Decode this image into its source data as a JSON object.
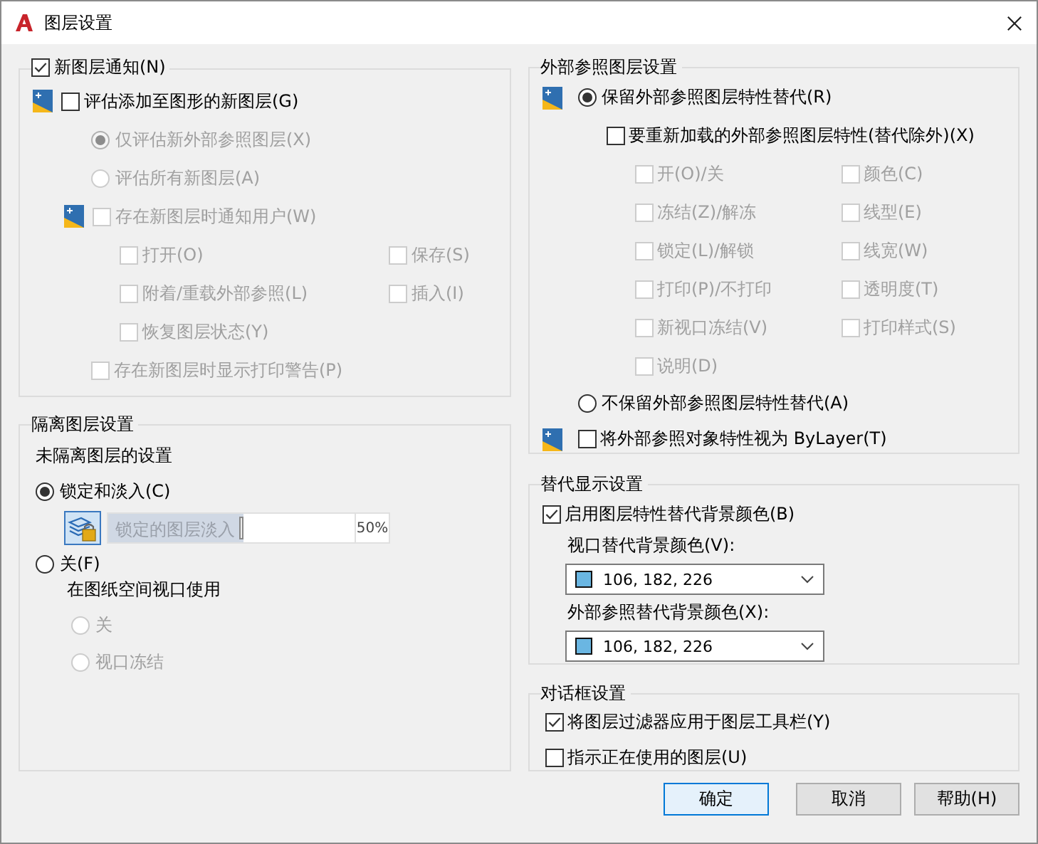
{
  "window": {
    "title": "图层设置"
  },
  "new_layer": {
    "label": "新图层通知(N)",
    "checked": true,
    "evaluate": {
      "label": "评估添加至图形的新图层(G)",
      "checked": false
    },
    "evaluate_options": [
      {
        "label": "仅评估新外部参照图层(X)",
        "selected": true,
        "disabled": true
      },
      {
        "label": "评估所有新图层(A)",
        "selected": false,
        "disabled": true
      }
    ],
    "notify": {
      "label": "存在新图层时通知用户(W)",
      "checked": false,
      "disabled": true
    },
    "notify_options": [
      {
        "label": "打开(O)",
        "checked": false,
        "disabled": true
      },
      {
        "label": "保存(S)",
        "checked": false,
        "disabled": true
      },
      {
        "label": "附着/重载外部参照(L)",
        "checked": false,
        "disabled": true
      },
      {
        "label": "插入(I)",
        "checked": false,
        "disabled": true
      },
      {
        "label": "恢复图层状态(Y)",
        "checked": false,
        "disabled": true
      }
    ],
    "plot_warning": {
      "label": "存在新图层时显示打印警告(P)",
      "checked": false,
      "disabled": true
    }
  },
  "isolate": {
    "title": "隔离图层设置",
    "subtitle": "未隔离图层的设置",
    "lock_fade": {
      "label": "锁定和淡入(C)",
      "selected": true
    },
    "fade": {
      "label": "锁定的图层淡入",
      "level": 0.55,
      "reading": "50%"
    },
    "off": {
      "label": "关(F)",
      "selected": false
    },
    "viewport_label": "在图纸空间视口使用",
    "viewport_options": [
      {
        "label": "关",
        "selected": false,
        "disabled": true
      },
      {
        "label": "视口冻结",
        "selected": false,
        "disabled": true
      }
    ]
  },
  "xref": {
    "title": "外部参照图层设置",
    "retain": {
      "label": "保留外部参照图层特性替代(R)",
      "selected": true
    },
    "reload": {
      "label": "要重新加载的外部参照图层特性(替代除外)(X)",
      "checked": false
    },
    "properties": [
      {
        "label": "开(O)/关",
        "checked": false,
        "disabled": true
      },
      {
        "label": "颜色(C)",
        "checked": false,
        "disabled": true
      },
      {
        "label": "冻结(Z)/解冻",
        "checked": false,
        "disabled": true
      },
      {
        "label": "线型(E)",
        "checked": false,
        "disabled": true
      },
      {
        "label": "锁定(L)/解锁",
        "checked": false,
        "disabled": true
      },
      {
        "label": "线宽(W)",
        "checked": false,
        "disabled": true
      },
      {
        "label": "打印(P)/不打印",
        "checked": false,
        "disabled": true
      },
      {
        "label": "透明度(T)",
        "checked": false,
        "disabled": true
      },
      {
        "label": "新视口冻结(V)",
        "checked": false,
        "disabled": true
      },
      {
        "label": "打印样式(S)",
        "checked": false,
        "disabled": true
      },
      {
        "label": "说明(D)",
        "checked": false,
        "disabled": true
      }
    ],
    "no_retain": {
      "label": "不保留外部参照图层特性替代(A)",
      "selected": false
    },
    "bylayer": {
      "label": "将外部参照对象特性视为 ByLayer(T)",
      "checked": false
    }
  },
  "override_display": {
    "title": "替代显示设置",
    "enable": {
      "label": "启用图层特性替代背景颜色(B)",
      "checked": true
    },
    "colors": [
      {
        "label": "视口替代背景颜色(V):",
        "value": "106, 182, 226",
        "color": "#6ab6e2"
      },
      {
        "label": "外部参照替代背景颜色(X):",
        "value": "106, 182, 226",
        "color": "#6ab6e2"
      }
    ]
  },
  "dialog": {
    "title": "对话框设置",
    "options": [
      {
        "label": "将图层过滤器应用于图层工具栏(Y)",
        "checked": true
      },
      {
        "label": "指示正在使用的图层(U)",
        "checked": false
      }
    ]
  },
  "buttons": [
    {
      "label": "确定",
      "default": true
    },
    {
      "label": "取消",
      "default": false
    },
    {
      "label": "帮助(H)",
      "default": false
    }
  ]
}
